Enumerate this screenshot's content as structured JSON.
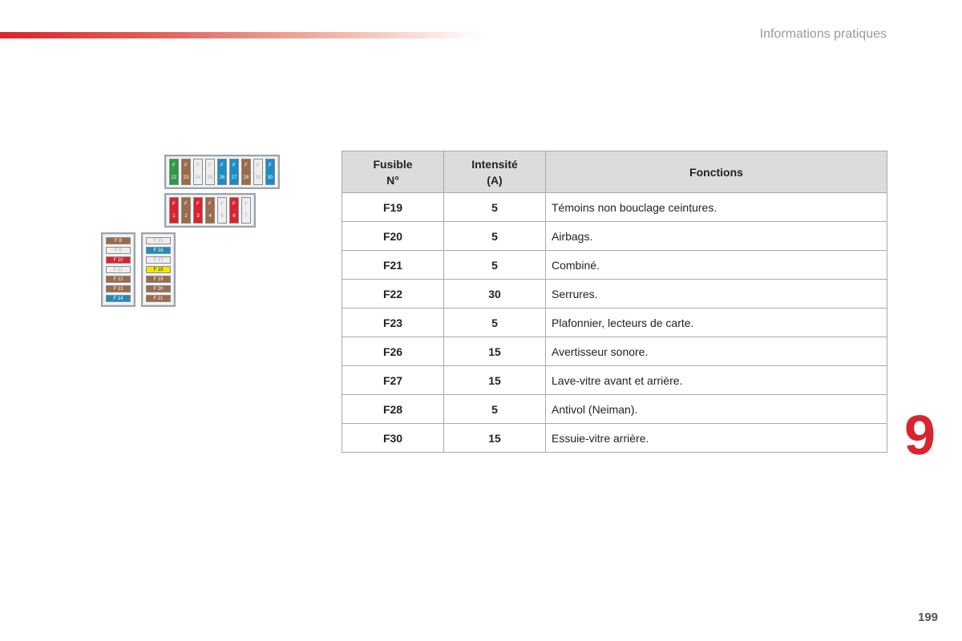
{
  "header": {
    "section_title": "Informations pratiques"
  },
  "chapter_number": "9",
  "page_number": "199",
  "colors": {
    "accent": "#d8242e",
    "header_bg": "#dcdcdc"
  },
  "diagram": {
    "top_row": [
      {
        "label": "F 22",
        "color": "green"
      },
      {
        "label": "F 23",
        "color": "brown"
      },
      {
        "label": "F 24",
        "color": "white"
      },
      {
        "label": "F 25",
        "color": "white"
      },
      {
        "label": "F 26",
        "color": "blue"
      },
      {
        "label": "F 27",
        "color": "blue"
      },
      {
        "label": "F 28",
        "color": "brown"
      },
      {
        "label": "F 29",
        "color": "white"
      },
      {
        "label": "F 30",
        "color": "blue"
      }
    ],
    "middle_row": [
      {
        "label": "F 1",
        "color": "red"
      },
      {
        "label": "F 2",
        "color": "brown"
      },
      {
        "label": "F 3",
        "color": "red"
      },
      {
        "label": "F 4",
        "color": "brown"
      },
      {
        "label": "F 5",
        "color": "white"
      },
      {
        "label": "F 6",
        "color": "red"
      },
      {
        "label": "F 7",
        "color": "white"
      }
    ],
    "left_column": [
      {
        "label": "F 8",
        "color": "brown"
      },
      {
        "label": "F 9",
        "color": "white"
      },
      {
        "label": "F 10",
        "color": "red"
      },
      {
        "label": "F 11",
        "color": "white"
      },
      {
        "label": "F 12",
        "color": "brown"
      },
      {
        "label": "F 13",
        "color": "brown"
      },
      {
        "label": "F 14",
        "color": "blue"
      }
    ],
    "right_column": [
      {
        "label": "F 15",
        "color": "white"
      },
      {
        "label": "F 16",
        "color": "blue"
      },
      {
        "label": "F 17",
        "color": "white"
      },
      {
        "label": "F 18",
        "color": "yellow"
      },
      {
        "label": "F 19",
        "color": "brown"
      },
      {
        "label": "F 20",
        "color": "brown"
      },
      {
        "label": "F 21",
        "color": "brown"
      }
    ]
  },
  "table": {
    "headers": {
      "fuse": "Fusible N°",
      "amp": "Intensité (A)",
      "func": "Fonctions"
    },
    "rows": [
      {
        "fuse": "F19",
        "amp": "5",
        "func": "Témoins non bouclage ceintures."
      },
      {
        "fuse": "F20",
        "amp": "5",
        "func": "Airbags."
      },
      {
        "fuse": "F21",
        "amp": "5",
        "func": "Combiné."
      },
      {
        "fuse": "F22",
        "amp": "30",
        "func": "Serrures."
      },
      {
        "fuse": "F23",
        "amp": "5",
        "func": "Plafonnier, lecteurs de carte."
      },
      {
        "fuse": "F26",
        "amp": "15",
        "func": "Avertisseur sonore."
      },
      {
        "fuse": "F27",
        "amp": "15",
        "func": "Lave-vitre avant et arrière."
      },
      {
        "fuse": "F28",
        "amp": "5",
        "func": "Antivol (Neiman)."
      },
      {
        "fuse": "F30",
        "amp": "15",
        "func": "Essuie-vitre arrière."
      }
    ]
  }
}
